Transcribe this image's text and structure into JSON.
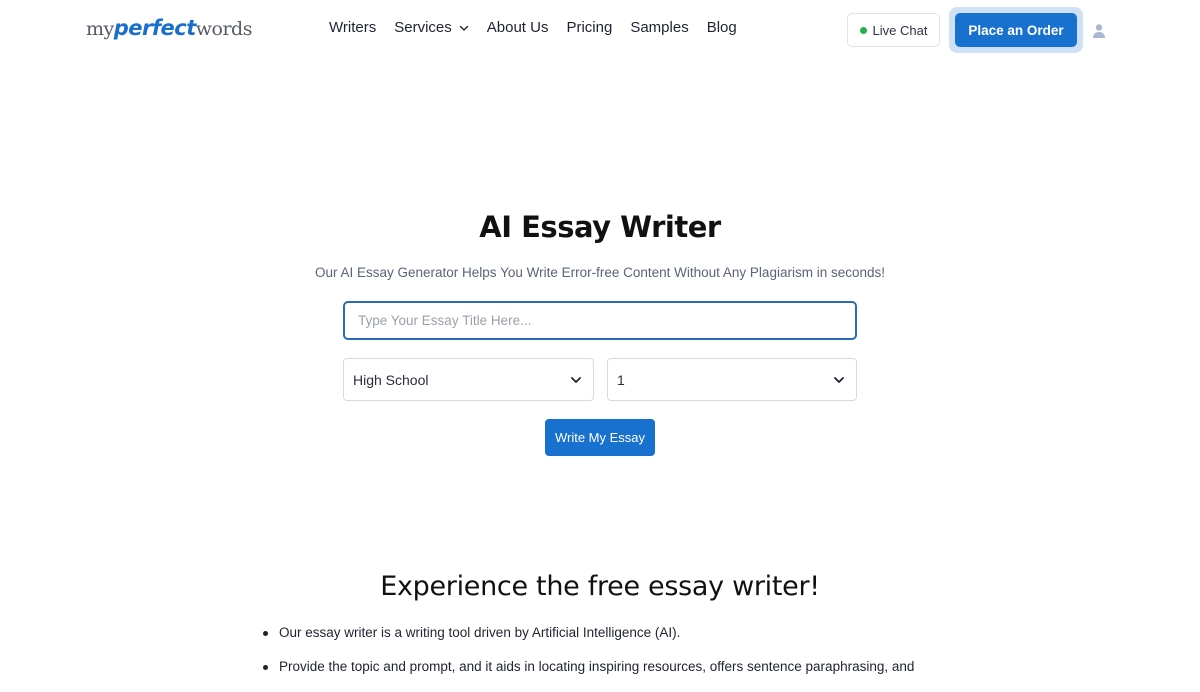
{
  "header": {
    "logo": {
      "part1": "my",
      "part2": "perfect",
      "part3": "words"
    },
    "nav": [
      {
        "label": "Writers"
      },
      {
        "label": "Services",
        "has_dropdown": true
      },
      {
        "label": "About Us"
      },
      {
        "label": "Pricing"
      },
      {
        "label": "Samples"
      },
      {
        "label": "Blog"
      }
    ],
    "live_chat_label": "Live Chat",
    "order_button_label": "Place an Order",
    "icons": {
      "services_chevron": "chevron-down-icon",
      "live_status": "green-dot-icon",
      "user": "user-icon"
    }
  },
  "hero": {
    "title": "AI Essay Writer",
    "subtitle": "Our AI Essay Generator Helps You Write Error-free Content Without Any Plagiarism in seconds!",
    "title_input": {
      "placeholder": "Type Your Essay Title Here...",
      "value": ""
    },
    "level_select": {
      "selected": "High School"
    },
    "pages_select": {
      "selected": "1"
    },
    "write_button_label": "Write My Essay"
  },
  "experience": {
    "title": "Experience the free essay writer!",
    "bullets": [
      "Our essay writer is a writing tool driven by Artificial Intelligence (AI).",
      "Provide the topic and prompt, and it aids in locating inspiring resources, offers sentence paraphrasing, and"
    ]
  },
  "colors": {
    "accent": "#1871cf",
    "accent_halo": "#cfe1f6",
    "live_green": "#22b14c",
    "input_border": "#2a6cb2",
    "subtitle_text": "#5a6478"
  }
}
